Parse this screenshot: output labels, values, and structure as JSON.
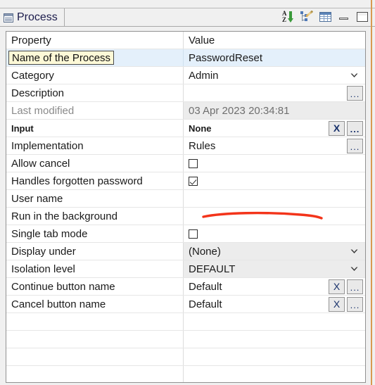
{
  "window": {
    "tab_label": "Process",
    "tab_icon": "properties-table-icon"
  },
  "toolbar": {
    "sort_label": "Sort alphabetically",
    "sort_icon": "sort-az-icon",
    "tree_label": "Show advanced properties",
    "tree_icon": "tree-edit-icon",
    "table_label": "Show categories",
    "table_icon": "table-icon",
    "minimize_label": "Minimize",
    "minimize_icon": "minimize-icon",
    "maximize_label": "Maximize",
    "maximize_icon": "maximize-icon",
    "sort_a": "A",
    "sort_z": "Z"
  },
  "table": {
    "headers": {
      "property": "Property",
      "value": "Value"
    },
    "rows": [
      {
        "property": "Name of the Process",
        "value": "PasswordReset",
        "state": "selected-editing",
        "widget": "text"
      },
      {
        "property": "Category",
        "value": "Admin",
        "state": "normal",
        "widget": "combo"
      },
      {
        "property": "Description",
        "value": "",
        "state": "normal",
        "widget": "dots"
      },
      {
        "property": "Last modified",
        "value": "03 Apr 2023 20:34:81",
        "state": "readonly",
        "widget": "none"
      },
      {
        "property": "Input",
        "value": "None",
        "state": "bold",
        "widget": "clear-dots"
      },
      {
        "property": "Implementation",
        "value": "Rules",
        "state": "normal",
        "widget": "dots"
      },
      {
        "property": "Allow cancel",
        "value": "",
        "state": "normal",
        "widget": "checkbox",
        "checked": false
      },
      {
        "property": "Handles forgotten password",
        "value": "",
        "state": "normal",
        "widget": "checkbox",
        "checked": true
      },
      {
        "property": "User name",
        "value": "",
        "state": "normal",
        "widget": "none"
      },
      {
        "property": "Run in the background",
        "value": "",
        "state": "normal",
        "widget": "none"
      },
      {
        "property": "Single tab mode",
        "value": "",
        "state": "normal",
        "widget": "checkbox",
        "checked": false
      },
      {
        "property": "Display under",
        "value": "(None)",
        "state": "shaded",
        "widget": "combo"
      },
      {
        "property": "Isolation level",
        "value": "DEFAULT",
        "state": "shaded",
        "widget": "combo"
      },
      {
        "property": "Continue button name",
        "value": "Default",
        "state": "normal",
        "widget": "clear-dots"
      },
      {
        "property": "Cancel button name",
        "value": "Default",
        "state": "normal",
        "widget": "clear-dots"
      },
      {
        "property": "",
        "value": "",
        "state": "empty",
        "widget": "none"
      },
      {
        "property": "",
        "value": "",
        "state": "empty",
        "widget": "none"
      },
      {
        "property": "",
        "value": "",
        "state": "empty",
        "widget": "none"
      },
      {
        "property": "",
        "value": "",
        "state": "empty",
        "widget": "none"
      }
    ]
  },
  "buttons": {
    "clear_label": "X",
    "browse_label": "...",
    "clear_icon": "clear-x-icon",
    "browse_icon": "ellipsis-browse-icon",
    "chevron_icon": "chevron-down-icon"
  },
  "annotation": {
    "type": "red-underline-stroke",
    "color": "#f3341a",
    "target": "Handles forgotten password"
  },
  "colors": {
    "selection": "#e4f0fb",
    "edit_cell": "#fdf9d7",
    "readonly": "#ececec",
    "accent_edge": "#d99a50",
    "annotation": "#f3341a"
  }
}
